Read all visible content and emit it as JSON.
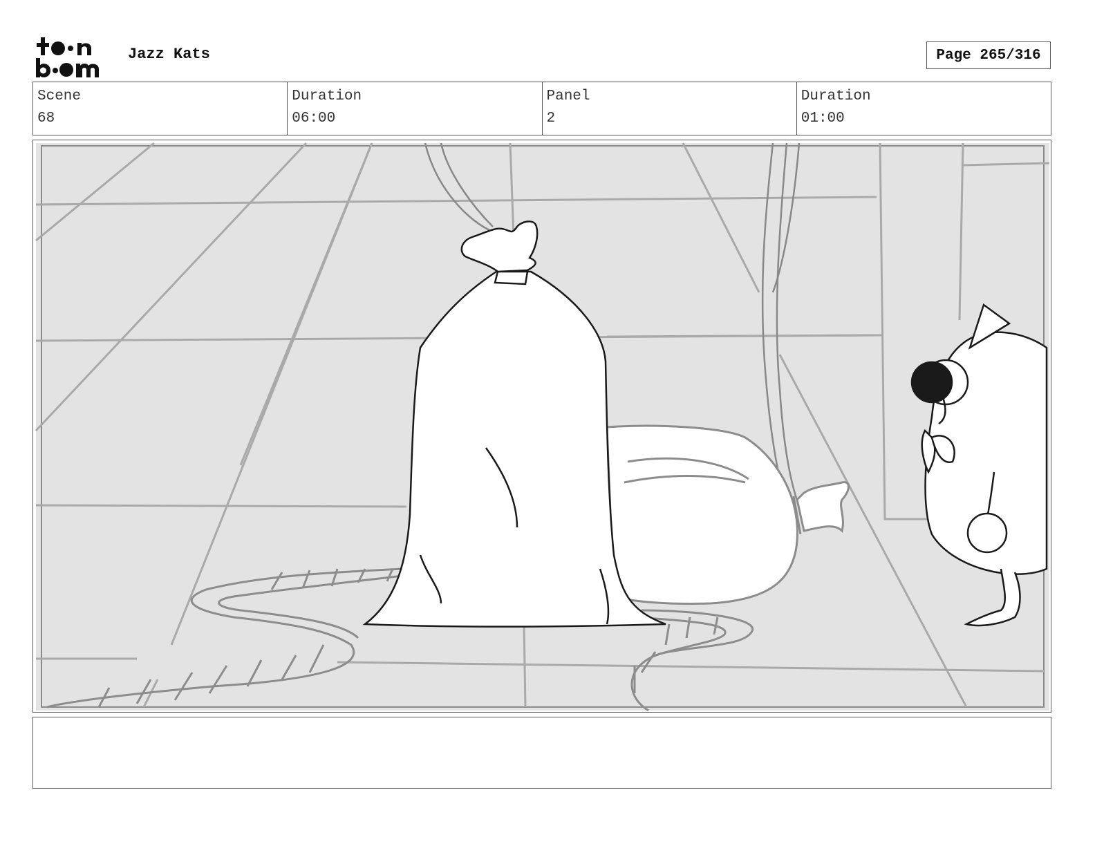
{
  "header": {
    "logo_text": "toon boom",
    "project_title": "Jazz Kats",
    "page_indicator": "Page 265/316"
  },
  "info": {
    "scene_label": "Scene",
    "scene_value": "68",
    "scene_duration_label": "Duration",
    "scene_duration_value": "06:00",
    "panel_label": "Panel",
    "panel_value": "2",
    "panel_duration_label": "Duration",
    "panel_duration_value": "01:00"
  },
  "notes": {
    "text": ""
  }
}
